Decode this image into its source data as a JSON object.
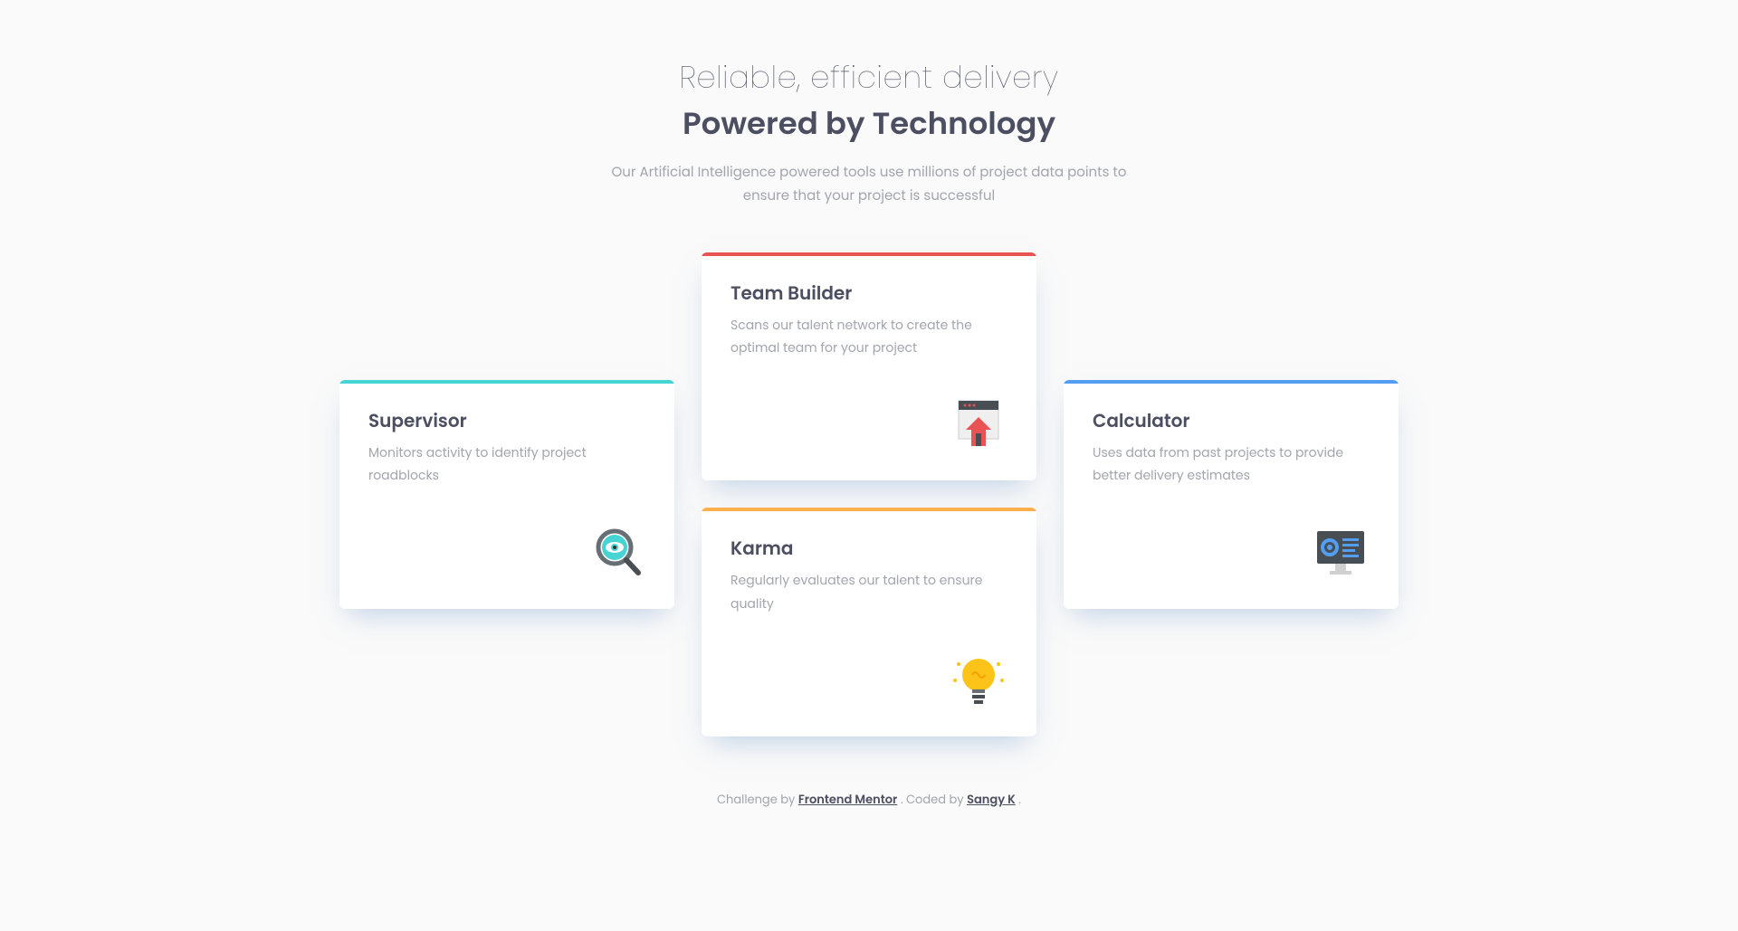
{
  "header": {
    "title_light": "Reliable, efficient delivery",
    "title_bold": "Powered by Technology",
    "subtitle": "Our Artificial Intelligence powered tools use millions of project data points to ensure that your project is successful"
  },
  "cards": {
    "supervisor": {
      "title": "Supervisor",
      "description": "Monitors activity to identify project roadblocks",
      "icon": "magnifier-eye-icon",
      "accent": "#45d3d3"
    },
    "team_builder": {
      "title": "Team Builder",
      "description": "Scans our talent network to create the optimal team for your project",
      "icon": "house-page-icon",
      "accent": "#ea5353"
    },
    "karma": {
      "title": "Karma",
      "description": "Regularly evaluates our talent to ensure quality",
      "icon": "lightbulb-icon",
      "accent": "#fcaf4a"
    },
    "calculator": {
      "title": "Calculator",
      "description": "Uses data from past projects to provide better delivery estimates",
      "icon": "monitor-icon",
      "accent": "#549ef2"
    }
  },
  "attribution": {
    "prefix": "Challenge by ",
    "link1_text": "Frontend Mentor",
    "middle": ". Coded by ",
    "link2_text": "Sangy K",
    "suffix": "."
  }
}
